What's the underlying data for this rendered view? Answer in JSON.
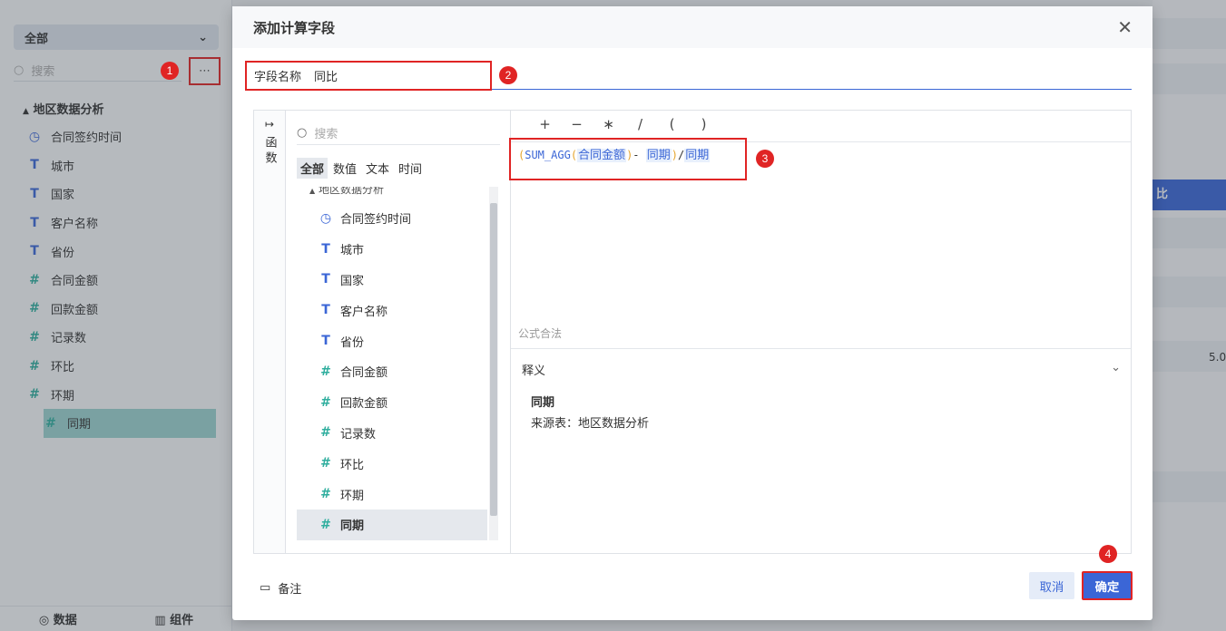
{
  "background": {
    "scope_select": "全部",
    "search_placeholder": "搜索",
    "tree_root": "地区数据分析",
    "fields": [
      {
        "label": "合同签约时间",
        "icon": "clock-icon"
      },
      {
        "label": "城市",
        "icon": "text-type-icon"
      },
      {
        "label": "国家",
        "icon": "text-type-icon"
      },
      {
        "label": "客户名称",
        "icon": "text-type-icon"
      },
      {
        "label": "省份",
        "icon": "text-type-icon"
      },
      {
        "label": "合同金额",
        "icon": "number-type-icon"
      },
      {
        "label": "回款金额",
        "icon": "number-type-icon"
      },
      {
        "label": "记录数",
        "icon": "calc-number-icon"
      },
      {
        "label": "环比",
        "icon": "calc-number-icon"
      },
      {
        "label": "环期",
        "icon": "calc-number-icon"
      },
      {
        "label": "同期",
        "icon": "calc-number-icon"
      }
    ],
    "bottom_tabs": [
      "数据",
      "组件"
    ],
    "right_header": "比",
    "right_values": [
      "5.0"
    ]
  },
  "badges": [
    "1",
    "2",
    "3",
    "4"
  ],
  "dialog": {
    "title": "添加计算字段",
    "field_name_label": "字段名称",
    "field_name_value": "同比",
    "function_tab": "函数",
    "search_placeholder": "搜索",
    "filter_tabs": [
      "全部",
      "数值",
      "文本",
      "时间"
    ],
    "tree_root": "地区数据分析",
    "fields": [
      {
        "label": "合同签约时间",
        "icon": "clock-icon"
      },
      {
        "label": "城市",
        "icon": "text-type-icon"
      },
      {
        "label": "国家",
        "icon": "text-type-icon"
      },
      {
        "label": "客户名称",
        "icon": "text-type-icon"
      },
      {
        "label": "省份",
        "icon": "text-type-icon"
      },
      {
        "label": "合同金额",
        "icon": "number-type-icon"
      },
      {
        "label": "回款金额",
        "icon": "number-type-icon"
      },
      {
        "label": "记录数",
        "icon": "calc-number-icon"
      },
      {
        "label": "环比",
        "icon": "calc-number-icon"
      },
      {
        "label": "环期",
        "icon": "calc-number-icon"
      },
      {
        "label": "同期",
        "icon": "calc-number-icon"
      }
    ],
    "operators": [
      "+",
      "−",
      "∗",
      "/",
      "(",
      ")"
    ],
    "formula": {
      "open1": "(",
      "func": "SUM_AGG",
      "open2": "(",
      "field1": "合同金额",
      "close2": ")",
      "minus": "-",
      "field2": "同期",
      "close1": ")",
      "divide": "/",
      "field3": "同期"
    },
    "formula_status": "公式合法",
    "explain_label": "释义",
    "explain_title": "同期",
    "explain_source": "来源表：地区数据分析",
    "note_label": "备注",
    "cancel_label": "取消",
    "ok_label": "确定"
  },
  "colors": {
    "accent": "#3b66d6",
    "highlight": "#e02424",
    "number_icon": "#2fae9e"
  }
}
